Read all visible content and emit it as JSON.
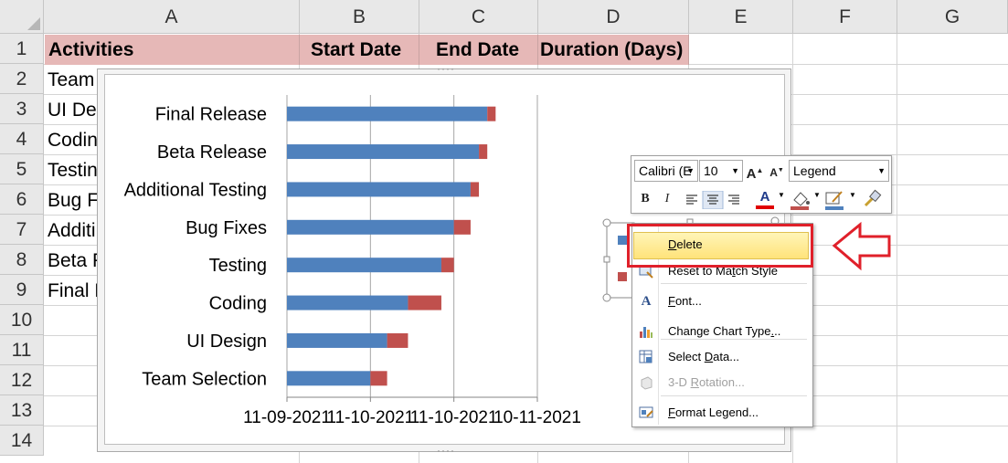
{
  "columns": [
    "A",
    "B",
    "C",
    "D",
    "E",
    "F",
    "G"
  ],
  "rows": [
    "1",
    "2",
    "3",
    "4",
    "5",
    "6",
    "7",
    "8",
    "9",
    "10",
    "11",
    "12",
    "13",
    "14"
  ],
  "headers": [
    "Activities",
    "Start Date",
    "End Date",
    "Duration (Days)"
  ],
  "activities_visible": [
    "Team",
    "UI Des",
    "Codin",
    "Testin",
    "Bug Fi",
    "Additi",
    "Beta R",
    "Final R"
  ],
  "colors": {
    "bar_start": "#4f81bd",
    "bar_duration": "#c0504d",
    "header_fill": "#e6b8b7",
    "menu_highlight": "#ffe37a",
    "callout_red": "#e0202a"
  },
  "chart_data": {
    "type": "bar",
    "orientation": "horizontal",
    "stacked": true,
    "categories": [
      "Final Release",
      "Beta Release",
      "Additional Testing",
      "Bug Fixes",
      "Testing",
      "Coding",
      "UI Design",
      "Team Selection"
    ],
    "series": [
      {
        "values": [
          48,
          46,
          44,
          40,
          37,
          29,
          24,
          20
        ]
      },
      {
        "values": [
          2,
          2,
          2,
          4,
          3,
          8,
          5,
          4
        ]
      }
    ],
    "xtick_labels": [
      "11-09-2021",
      "11-10-2021",
      "11-10-2021",
      "10-11-2021"
    ],
    "xlim": [
      0,
      60
    ],
    "grid": true
  },
  "mini_toolbar": {
    "font_name": "Calibri (E",
    "font_size": "10",
    "element": "Legend",
    "bold": "B",
    "italic": "I",
    "grow_font": "A",
    "shrink_font": "A",
    "font_color": "A"
  },
  "context_menu": [
    {
      "label": "Delete",
      "underline_index": 0,
      "icon": "none",
      "highlighted": true,
      "disabled": false
    },
    {
      "label": "Reset to Match Style",
      "underline_index": 11,
      "icon": "reset-style-icon",
      "disabled": false
    },
    {
      "label": "Font...",
      "underline_index": 0,
      "icon": "font-icon",
      "disabled": false
    },
    {
      "label": "Change Chart Type...",
      "underline_index": 17,
      "icon": "chart-type-icon",
      "disabled": false
    },
    {
      "label": "Select Data...",
      "underline_index": 7,
      "icon": "select-data-icon",
      "disabled": false
    },
    {
      "label": "3-D Rotation...",
      "underline_index": 4,
      "icon": "rotation-icon",
      "disabled": true
    },
    {
      "label": "Format Legend...",
      "underline_index": 0,
      "icon": "format-icon",
      "disabled": false
    }
  ]
}
